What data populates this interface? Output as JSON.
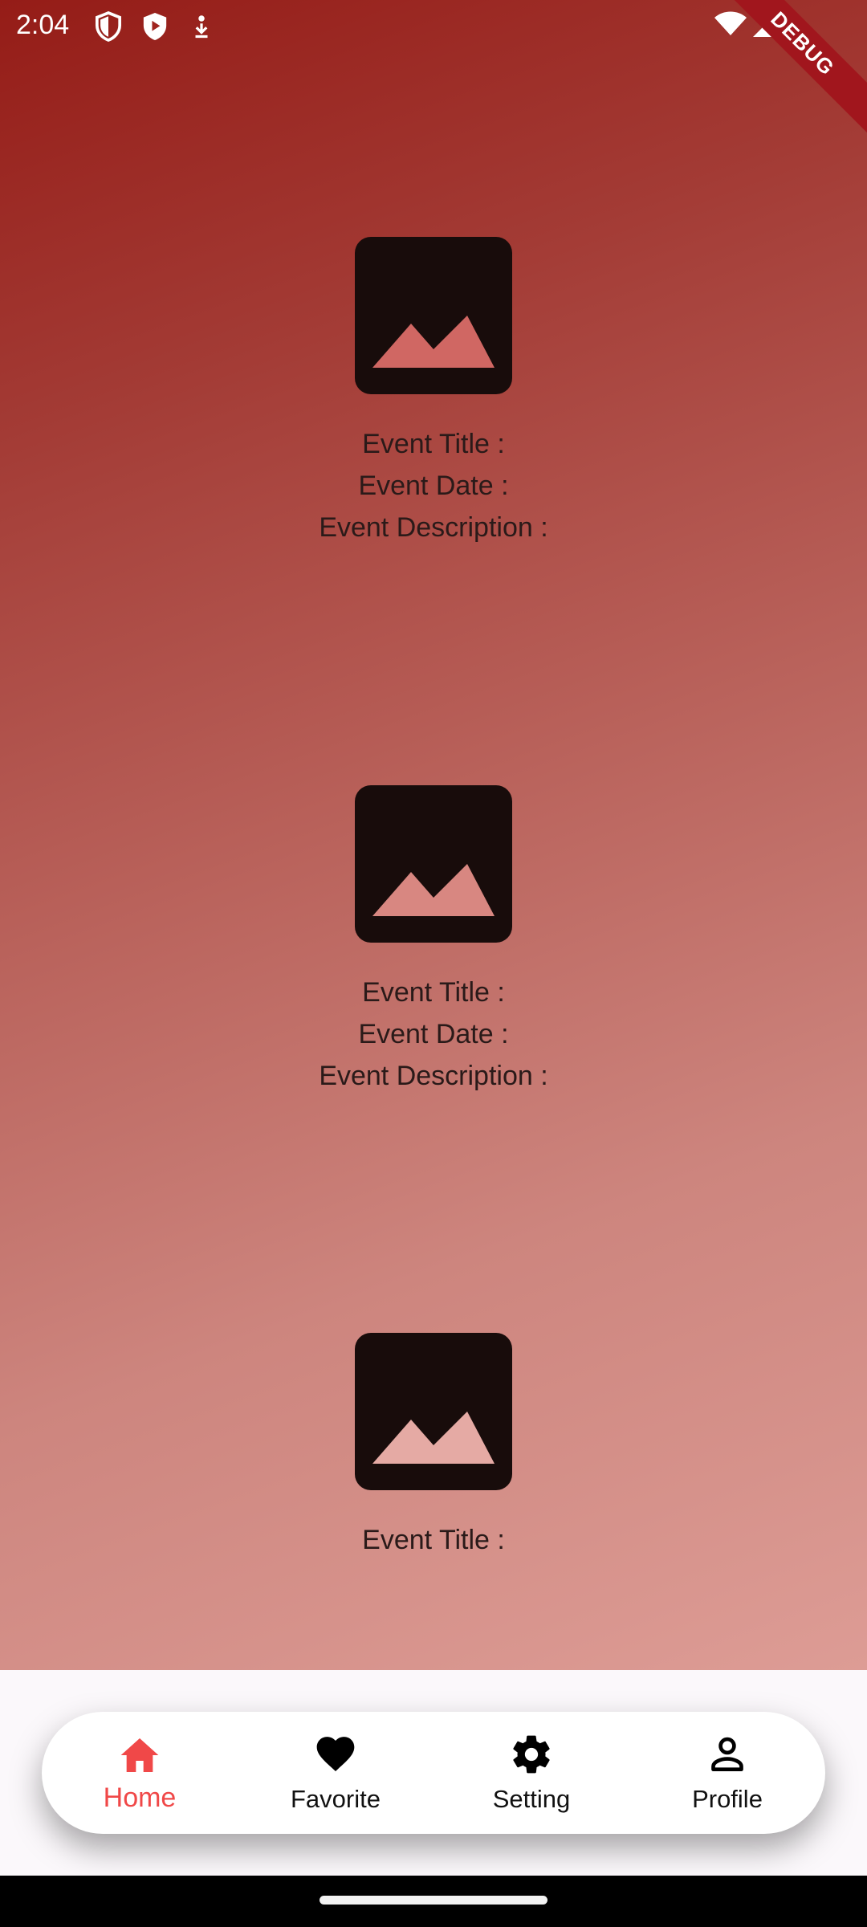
{
  "status_bar": {
    "time": "2:04",
    "left_icons": [
      "shield-icon",
      "play-shield-icon",
      "download-arrow-icon"
    ],
    "right_icons": [
      "wifi-icon",
      "cellular-signal-icon"
    ]
  },
  "debug_banner": "DEBUG",
  "events": [
    {
      "image_icon": "image-placeholder-icon",
      "lines": [
        "Event Title :",
        "Event Date :",
        "Event Description :"
      ]
    },
    {
      "image_icon": "image-placeholder-icon",
      "lines": [
        "Event Title :",
        "Event Date :",
        "Event Description :"
      ]
    },
    {
      "image_icon": "image-placeholder-icon",
      "lines": [
        "Event Title :"
      ]
    }
  ],
  "bottom_nav": {
    "active_color": "#f04848",
    "items": [
      {
        "label": "Home",
        "icon": "home-icon",
        "active": true
      },
      {
        "label": "Favorite",
        "icon": "heart-icon",
        "active": false
      },
      {
        "label": "Setting",
        "icon": "gear-icon",
        "active": false
      },
      {
        "label": "Profile",
        "icon": "person-icon",
        "active": false
      }
    ]
  }
}
